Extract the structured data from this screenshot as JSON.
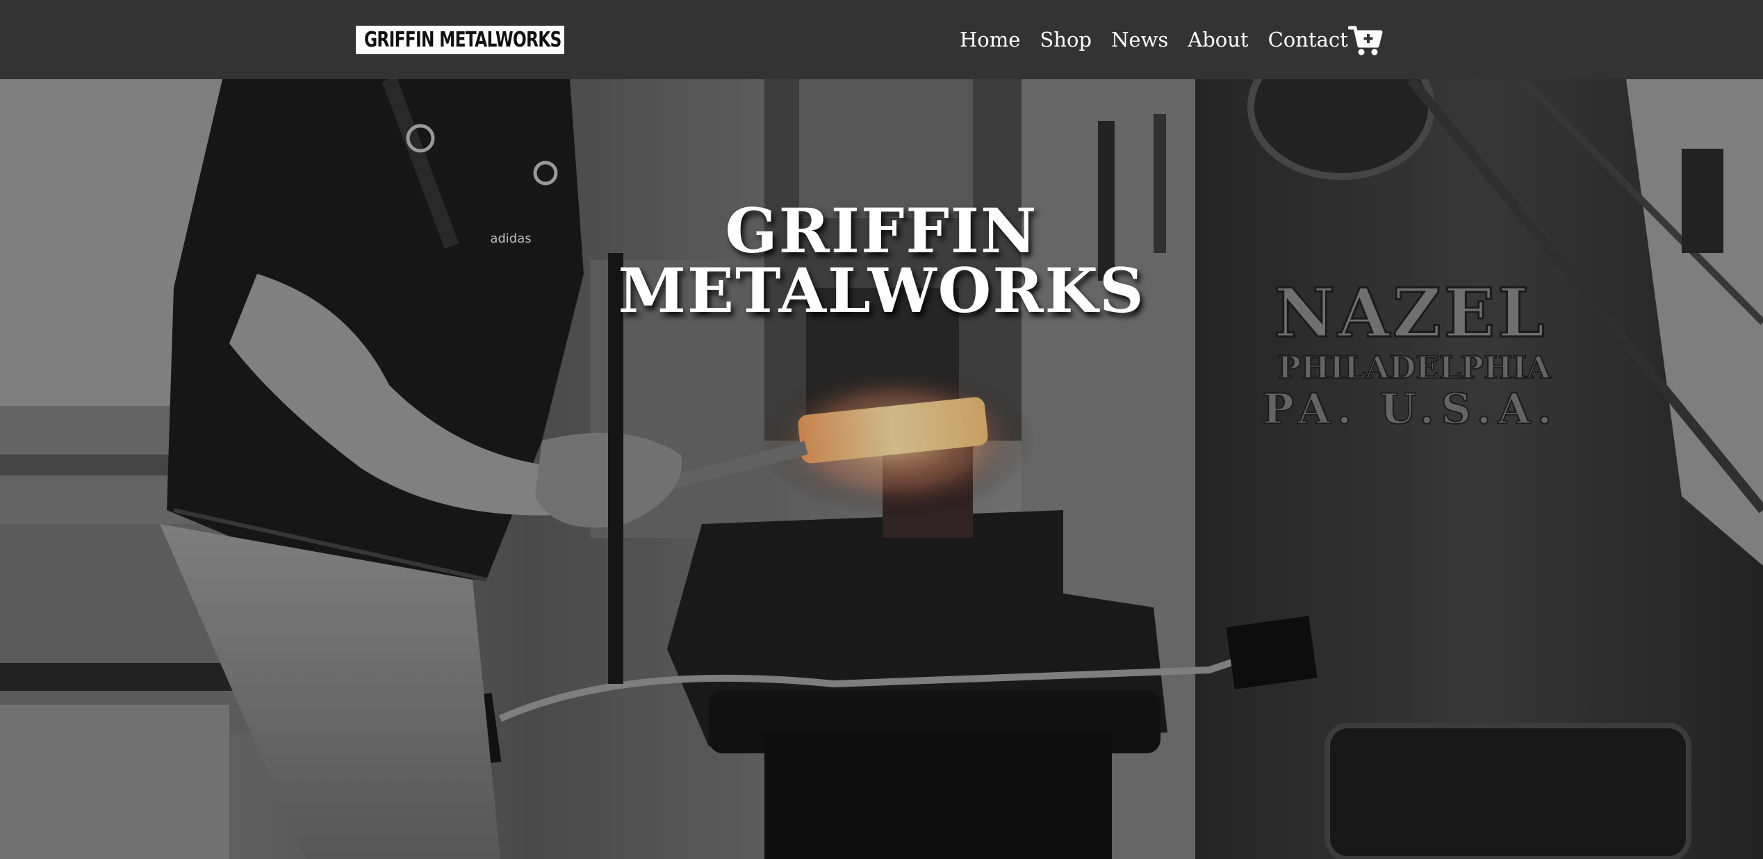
{
  "brand": {
    "logo_text": "GRIFFIN METALWORKS",
    "logo_icon": "griffin-icon"
  },
  "nav": {
    "items": [
      {
        "label": "Home"
      },
      {
        "label": "Shop"
      },
      {
        "label": "News"
      },
      {
        "label": "About"
      },
      {
        "label": "Contact"
      }
    ],
    "cart_icon": "cart-plus-icon"
  },
  "hero": {
    "title_line1": "GRIFFIN",
    "title_line2": "METALWORKS",
    "machine_plate_line1": "NAZEL",
    "machine_plate_line2": "PHILADELPHIA",
    "machine_plate_line3": "PA. U.S.A.",
    "shirt_logo": "adidas"
  },
  "colors": {
    "navbar_bg": "#333333",
    "text_light": "#ffffff",
    "hot_metal": "#f3c27a"
  }
}
